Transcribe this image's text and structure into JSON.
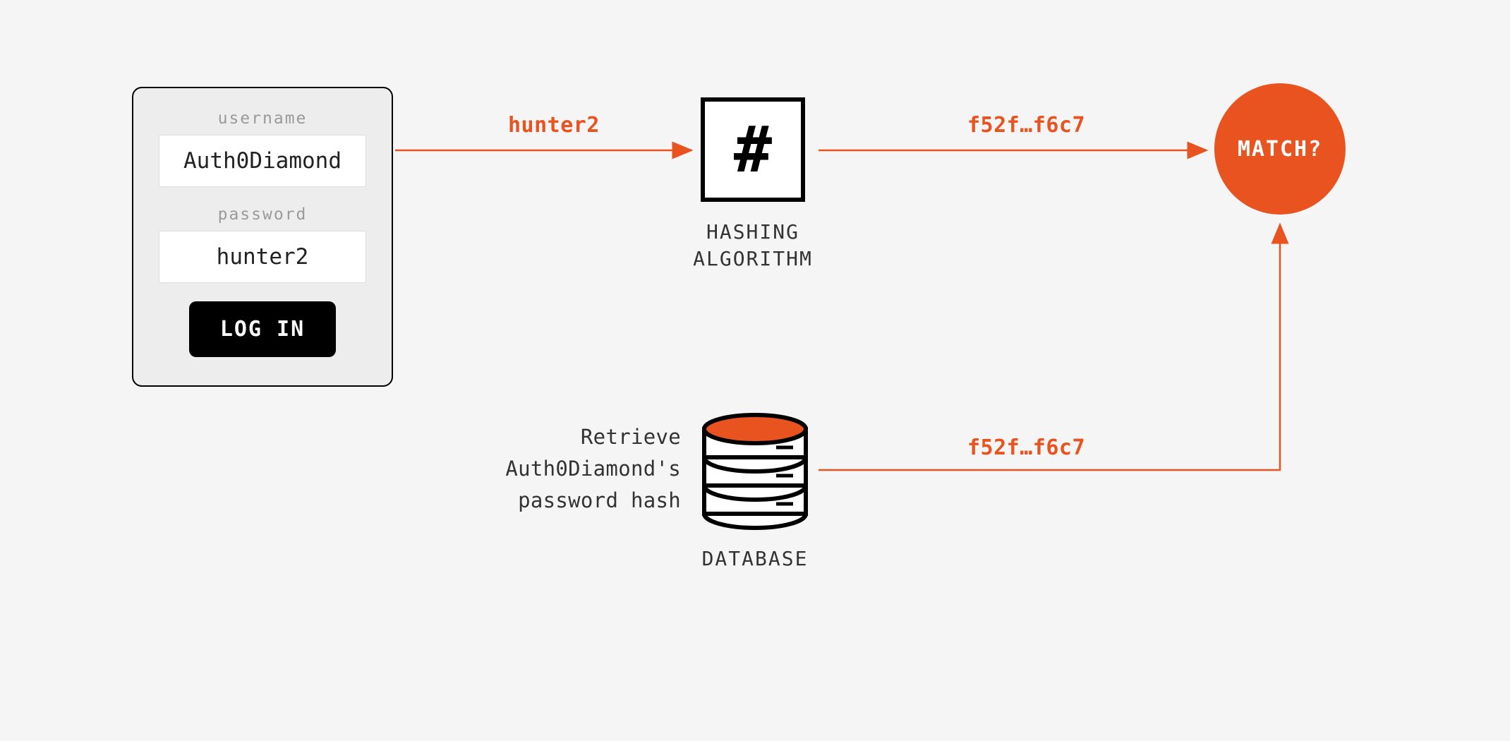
{
  "login": {
    "username_label": "username",
    "username_value": "Auth0Diamond",
    "password_label": "password",
    "password_value": "hunter2",
    "button_label": "LOG IN"
  },
  "hash": {
    "symbol": "#",
    "label": "HASHING ALGORITHM"
  },
  "match": {
    "label": "MATCH?"
  },
  "database": {
    "label": "DATABASE",
    "retrieve_text": "Retrieve Auth0Diamond's password hash"
  },
  "edges": {
    "password_to_hash": "hunter2",
    "hash_to_match": "f52f…f6c7",
    "db_to_match": "f52f…f6c7"
  },
  "colors": {
    "accent": "#e9531f",
    "bg": "#f5f5f5"
  }
}
